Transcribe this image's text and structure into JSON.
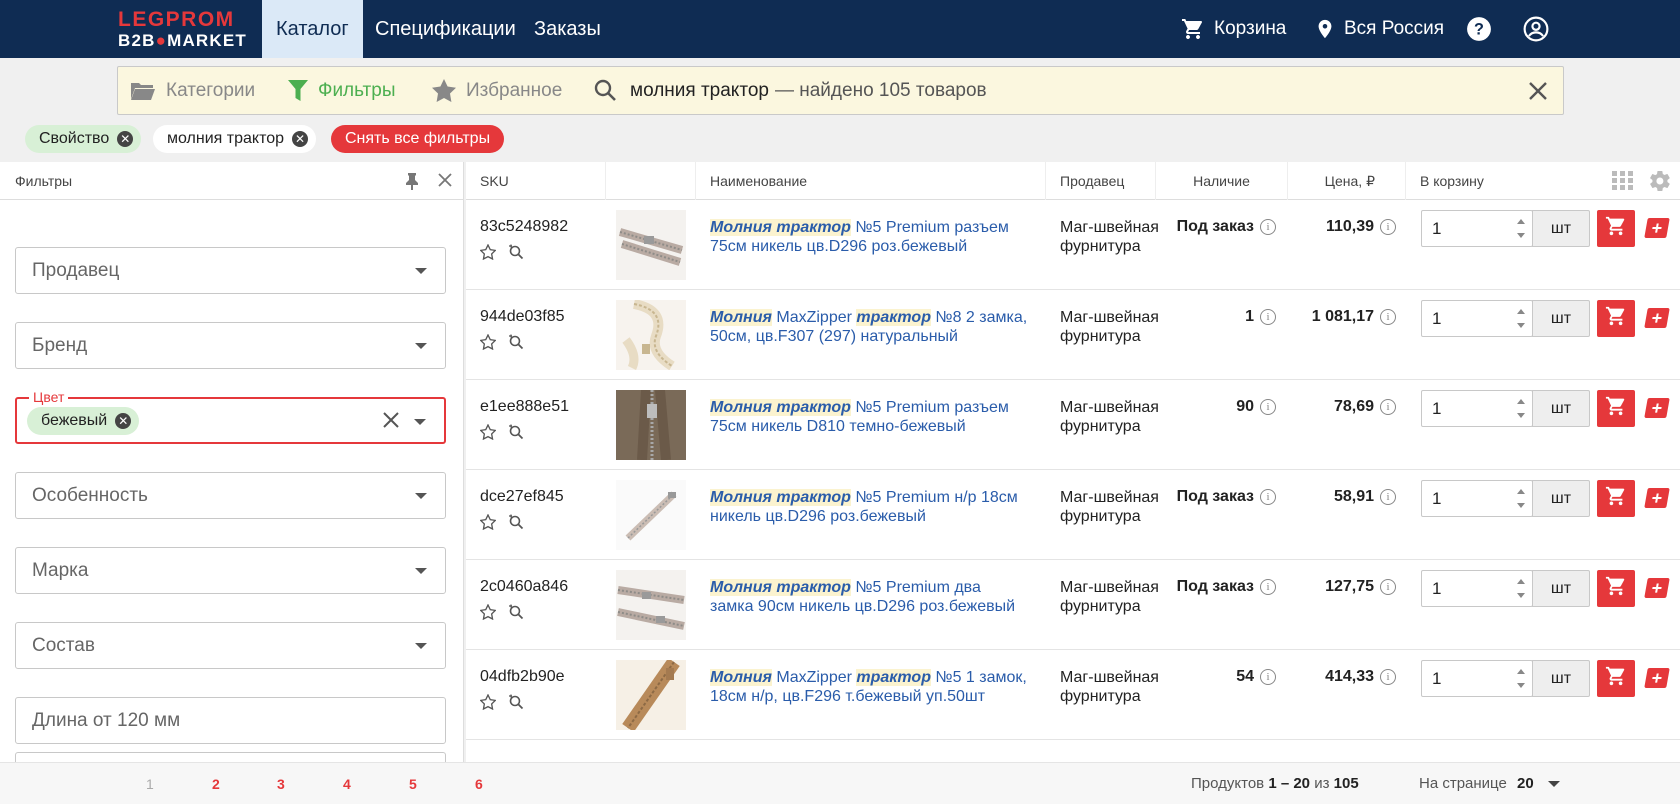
{
  "header": {
    "logo_line1": "LEGPROM",
    "logo_line2a": "B2B",
    "logo_line2b": "MARKET",
    "tabs": [
      "Каталог",
      "Спецификации",
      "Заказы"
    ],
    "active_tab": "Каталог",
    "cart_label": "Корзина",
    "region_label": "Вся Россия"
  },
  "searchbar": {
    "categories": "Категории",
    "filters": "Фильтры",
    "favorites": "Избранное",
    "query": "молния трактор",
    "result_text": "— найдено 105 товаров"
  },
  "chips": {
    "property": "Свойство",
    "query": "молния трактор",
    "reset": "Снять все фильтры"
  },
  "filters_panel": {
    "title": "Фильтры",
    "fields": [
      {
        "label": "Продавец"
      },
      {
        "label": "Бренд"
      },
      {
        "label": "Цвет",
        "value": "бежевый"
      },
      {
        "label": "Особенность"
      },
      {
        "label": "Марка"
      },
      {
        "label": "Состав"
      },
      {
        "label": "Длина от 120 мм"
      }
    ]
  },
  "table": {
    "columns": [
      "SKU",
      "Наименование",
      "Продавец",
      "Наличие",
      "Цена, ₽",
      "В корзину"
    ],
    "rows": [
      {
        "sku": "83c5248982",
        "name_parts": [
          [
            "Молния трактор",
            true
          ],
          [
            " №5 Premium разъем 75см никель цв.D296 роз.бежевый",
            false
          ]
        ],
        "seller": "Маг-швейная фурнитура",
        "stock": "Под заказ",
        "price": "110,39",
        "qty": "1",
        "unit": "шт"
      },
      {
        "sku": "944de03f85",
        "name_parts": [
          [
            "Молния",
            true
          ],
          [
            " MaxZipper ",
            false
          ],
          [
            "трактор",
            true
          ],
          [
            " №8 2 замка, 50см, цв.F307 (297) натуральный",
            false
          ]
        ],
        "seller": "Маг-швейная фурнитура",
        "stock": "1",
        "price": "1 081,17",
        "qty": "1",
        "unit": "шт"
      },
      {
        "sku": "e1ee888e51",
        "name_parts": [
          [
            "Молния трактор",
            true
          ],
          [
            " №5 Premium разъем 75см никель D810 темно-бежевый",
            false
          ]
        ],
        "seller": "Маг-швейная фурнитура",
        "stock": "90",
        "price": "78,69",
        "qty": "1",
        "unit": "шт"
      },
      {
        "sku": "dce27ef845",
        "name_parts": [
          [
            "Молния трактор",
            true
          ],
          [
            " №5 Premium н/р 18см никель цв.D296 роз.бежевый",
            false
          ]
        ],
        "seller": "Маг-швейная фурнитура",
        "stock": "Под заказ",
        "price": "58,91",
        "qty": "1",
        "unit": "шт"
      },
      {
        "sku": "2c0460a846",
        "name_parts": [
          [
            "Молния трактор",
            true
          ],
          [
            " №5 Premium два замка 90см никель цв.D296 роз.бежевый",
            false
          ]
        ],
        "seller": "Маг-швейная фурнитура",
        "stock": "Под заказ",
        "price": "127,75",
        "qty": "1",
        "unit": "шт"
      },
      {
        "sku": "04dfb2b90e",
        "name_parts": [
          [
            "Молния",
            true
          ],
          [
            " MaxZipper ",
            false
          ],
          [
            "трактор",
            true
          ],
          [
            " №5 1 замок, 18см н/р, цв.F296 т.бежевый уп.50шт",
            false
          ]
        ],
        "seller": "Маг-швейная фурнитура",
        "stock": "54",
        "price": "414,33",
        "qty": "1",
        "unit": "шт"
      }
    ]
  },
  "footer": {
    "pages": [
      "1",
      "2",
      "3",
      "4",
      "5",
      "6"
    ],
    "current_page": "1",
    "count_prefix": "Продуктов",
    "count_range": "1 – 20",
    "count_of": "из",
    "count_total": "105",
    "per_page_label": "На странице",
    "per_page_value": "20"
  },
  "colors": {
    "header_bg": "#0f2c53",
    "accent_red": "#e5383b",
    "link_blue": "#2a5caa",
    "filter_green": "#4caf50"
  }
}
